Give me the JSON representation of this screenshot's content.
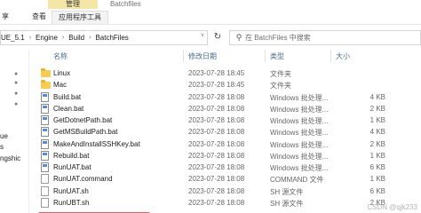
{
  "ribbon": {
    "context_group": "管理",
    "window_title": "Batchfiles",
    "tabs": {
      "left": "享",
      "view": "查看",
      "tools": "应用程序工具"
    }
  },
  "address": {
    "crumbs": [
      "UE_5.1",
      "Engine",
      "Build",
      "BatchFiles"
    ],
    "separator": "›",
    "dropdown": "˅",
    "refresh": "↻"
  },
  "search": {
    "placeholder": "在 BatchFiles 中搜索"
  },
  "nav": {
    "items": [
      "ue",
      "s",
      "ngshic"
    ]
  },
  "columns": {
    "name": "名称",
    "date": "修改日期",
    "type": "类型",
    "size": "大小",
    "sort_indicator": "^"
  },
  "files": [
    {
      "name": "Linux",
      "date": "2023-07-28 18:45",
      "type": "文件夹",
      "size": "",
      "kind": "folder"
    },
    {
      "name": "Mac",
      "date": "2023-07-28 18:45",
      "type": "文件夹",
      "size": "",
      "kind": "folder"
    },
    {
      "name": "Build.bat",
      "date": "2023-07-28 18:08",
      "type": "Windows 批处理...",
      "size": "4 KB",
      "kind": "bat"
    },
    {
      "name": "Clean.bat",
      "date": "2023-07-28 18:08",
      "type": "Windows 批处理...",
      "size": "2 KB",
      "kind": "bat"
    },
    {
      "name": "GetDotnetPath.bat",
      "date": "2023-07-28 18:08",
      "type": "Windows 批处理...",
      "size": "1 KB",
      "kind": "bat"
    },
    {
      "name": "GetMSBuildPath.bat",
      "date": "2023-07-28 18:08",
      "type": "Windows 批处理...",
      "size": "4 KB",
      "kind": "bat"
    },
    {
      "name": "MakeAndInstallSSHKey.bat",
      "date": "2023-07-28 18:08",
      "type": "Windows 批处理...",
      "size": "2 KB",
      "kind": "bat"
    },
    {
      "name": "Rebuild.bat",
      "date": "2023-07-28 18:08",
      "type": "Windows 批处理...",
      "size": "1 KB",
      "kind": "bat"
    },
    {
      "name": "RunUAT.bat",
      "date": "2023-07-28 18:08",
      "type": "Windows 批处理...",
      "size": "6 KB",
      "kind": "bat"
    },
    {
      "name": "RunUAT.command",
      "date": "2023-07-28 18:08",
      "type": "COMMAND 文件",
      "size": "1 KB",
      "kind": "sh"
    },
    {
      "name": "RunUAT.sh",
      "date": "2023-07-28 18:08",
      "type": "SH 源文件",
      "size": "6 KB",
      "kind": "sh"
    },
    {
      "name": "RunUBT.sh",
      "date": "2023-07-28 18:08",
      "type": "SH 源文件",
      "size": "2 KB",
      "kind": "sh"
    }
  ],
  "watermark": "CSDN @qjk233",
  "colors": {
    "folder": "#f6cc55",
    "annotation_underline": "#d7474e",
    "context_tab": "#f4e6a6"
  }
}
